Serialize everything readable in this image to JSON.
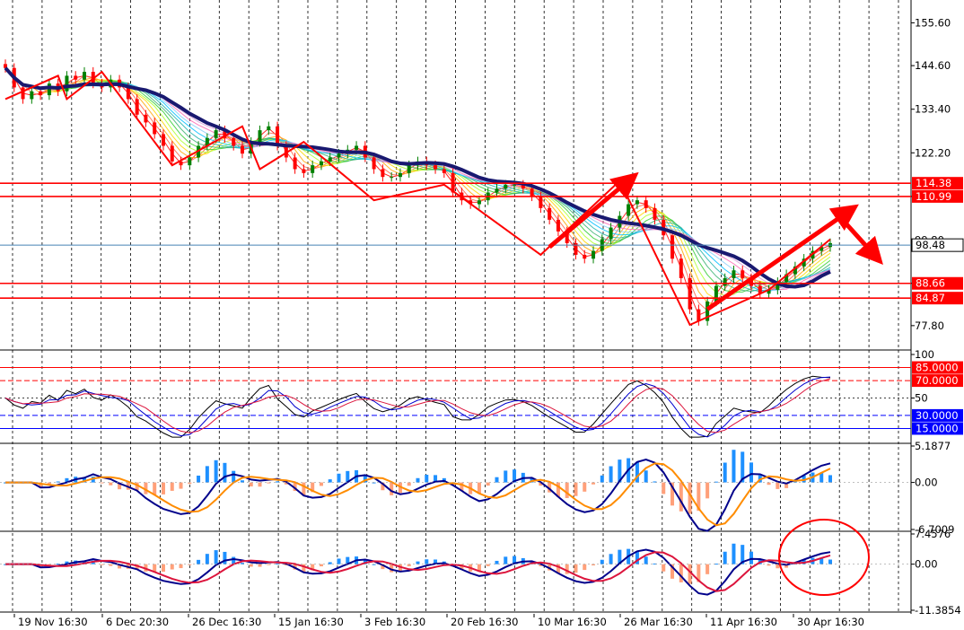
{
  "chart_data": {
    "type": "candlestick",
    "panels": [
      {
        "name": "price",
        "ylim": [
          72.0,
          161.0
        ],
        "y_ticks": [
          "155.60",
          "144.60",
          "133.40",
          "122.20",
          "110.99",
          "99.80",
          "88.66",
          "77.80"
        ],
        "current_price": {
          "label": "98.48",
          "value": 98.48
        },
        "levels": [
          {
            "label": "114.38",
            "value": 114.38,
            "color": "#ff0000"
          },
          {
            "label": "110.99",
            "value": 110.99,
            "color": "#ff0000"
          },
          {
            "label": "88.66",
            "value": 88.66,
            "color": "#ff0000"
          },
          {
            "label": "84.87",
            "value": 84.87,
            "color": "#ff0000"
          }
        ],
        "close": [
          144,
          139,
          136,
          138,
          137,
          140,
          138,
          142,
          141,
          143,
          140,
          139,
          141,
          139,
          136,
          132,
          130,
          127,
          124,
          120,
          119,
          121,
          124,
          126,
          128,
          126,
          124,
          122,
          125,
          128,
          129,
          124,
          121,
          118,
          117,
          119,
          120,
          121,
          122,
          123,
          124,
          121,
          118,
          116,
          116,
          117,
          119,
          120,
          119,
          118,
          117,
          112,
          110,
          109,
          110,
          112,
          113,
          114,
          114,
          113,
          111,
          108,
          105,
          102,
          99,
          96,
          95,
          97,
          100,
          103,
          106,
          109,
          110,
          108,
          105,
          101,
          95,
          90,
          82,
          79,
          84,
          88,
          90,
          92,
          90,
          88,
          86,
          87,
          89,
          91,
          93,
          95,
          97,
          98,
          99
        ],
        "zigzag": [
          [
            0,
            136
          ],
          [
            6,
            142
          ],
          [
            7,
            136
          ],
          [
            11,
            143
          ],
          [
            19,
            119
          ],
          [
            27,
            129
          ],
          [
            29,
            118
          ],
          [
            34,
            125
          ],
          [
            42,
            110
          ],
          [
            50,
            114
          ],
          [
            61,
            96
          ],
          [
            70,
            115
          ],
          [
            78,
            78
          ],
          [
            87,
            87
          ],
          [
            94,
            100
          ]
        ],
        "arrows": [
          {
            "from": [
              62,
              98
            ],
            "to": [
              71,
              115
            ]
          },
          {
            "from": [
              80,
              82
            ],
            "to": [
              96,
              107
            ]
          },
          {
            "from": [
              95,
              106
            ],
            "to": [
              99,
              96
            ]
          }
        ]
      },
      {
        "name": "oscillator",
        "ylim": [
          0,
          100
        ],
        "y_ticks": [
          "100",
          "50"
        ],
        "levels": [
          {
            "label": "85.0000",
            "value": 85,
            "color": "#ff0000"
          },
          {
            "label": "70.0000",
            "value": 70,
            "color": "#ff0000"
          },
          {
            "label": "30.0000",
            "value": 30,
            "color": "#0000ff"
          },
          {
            "label": "15.0000",
            "value": 15,
            "color": "#0000ff"
          }
        ]
      },
      {
        "name": "histogram-1",
        "ylim": [
          -6.7009,
          5.1877
        ],
        "y_ticks": [
          "5.1877",
          "0.00",
          "-6.7009"
        ]
      },
      {
        "name": "histogram-2",
        "ylim": [
          -11.3854,
          7.4576
        ],
        "y_ticks": [
          "7.4576",
          "0.00",
          "-11.3854"
        ],
        "annotation": "circle"
      }
    ],
    "x_ticks": [
      "19 Nov 16:30",
      "6 Dec 20:30",
      "26 Dec 16:30",
      "15 Jan 16:30",
      "3 Feb 16:30",
      "20 Feb 16:30",
      "10 Mar 16:30",
      "26 Mar 16:30",
      "11 Apr 16:30",
      "30 Apr 16:30"
    ],
    "colors": {
      "bull": "#008000",
      "bear": "#ff0000",
      "slow_ma": "#191970",
      "level_red": "#ff0000",
      "level_blue": "#0000ff",
      "price_line": "#4682b4",
      "hist_pos": "#1e90ff",
      "hist_neg": "#ffa07a",
      "signal_orange": "#ff8c00",
      "signal_blue": "#00008b",
      "signal_red": "#dc143c",
      "grid": "#000000"
    }
  }
}
